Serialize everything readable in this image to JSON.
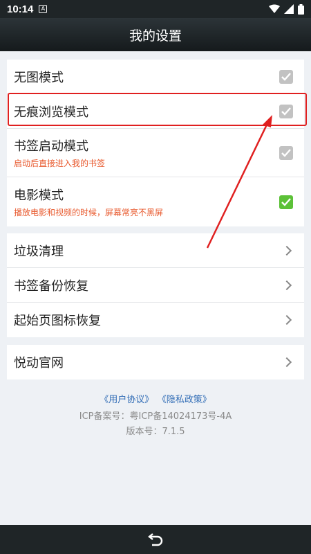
{
  "status_bar": {
    "time": "10:14",
    "notification_glyph": "A"
  },
  "header": {
    "title": "我的设置"
  },
  "toggles": [
    {
      "title": "无图模式",
      "subtitle": "",
      "checked": true,
      "color": "#c2c2c2"
    },
    {
      "title": "无痕浏览模式",
      "subtitle": "",
      "checked": true,
      "color": "#c2c2c2"
    },
    {
      "title": "书签启动模式",
      "subtitle": "启动后直接进入我的书签",
      "checked": true,
      "color": "#c2c2c2"
    },
    {
      "title": "电影模式",
      "subtitle": "播放电影和视频的时候，屏幕常亮不黑屏",
      "checked": true,
      "color": "#5cc138"
    }
  ],
  "actions": [
    {
      "title": "垃圾清理"
    },
    {
      "title": "书签备份恢复"
    },
    {
      "title": "起始页图标恢复"
    }
  ],
  "website": {
    "title": "悦动官网"
  },
  "footer": {
    "user_agreement": "《用户协议》",
    "privacy_policy": "《隐私政策》",
    "icp": "ICP备案号：粤ICP备14024173号-4A",
    "version": "版本号：7.1.5"
  },
  "colors": {
    "accent_orange": "#e8582c",
    "highlight_red": "#e02020",
    "link_blue": "#2f6bb5"
  }
}
